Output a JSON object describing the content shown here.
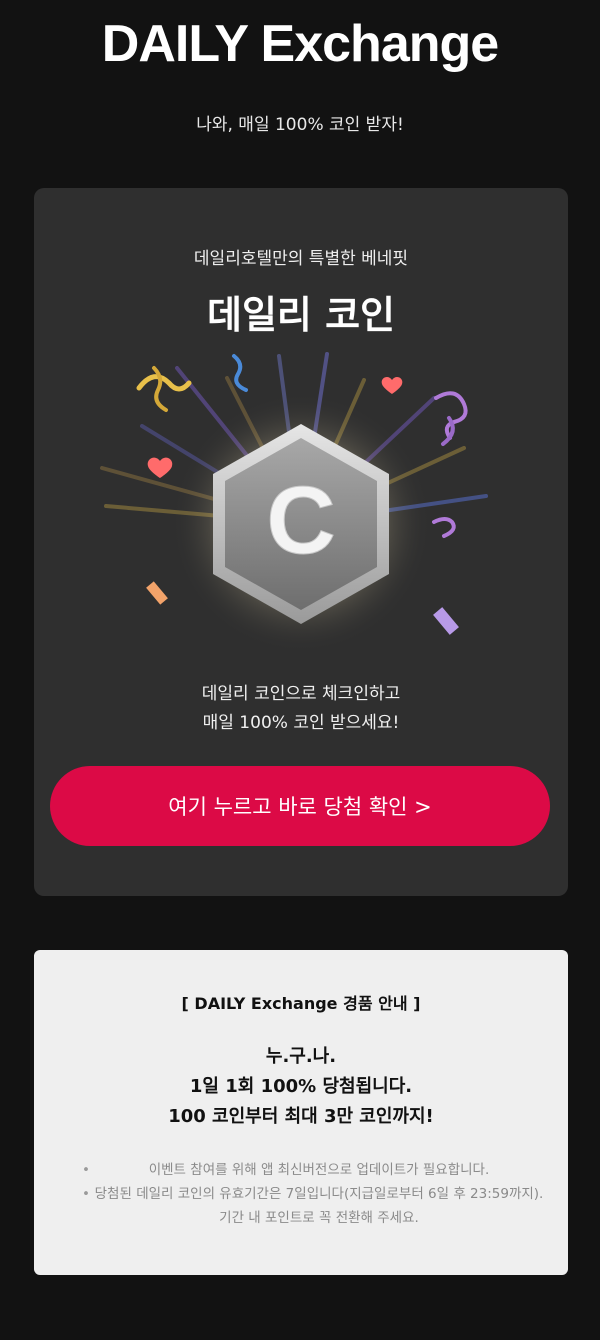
{
  "header": {
    "title": "DAILY Exchange",
    "subtitle": "나와, 매일 100% 코인 받자!"
  },
  "promo_card": {
    "eyebrow": "데일리호텔만의 특별한 베네핏",
    "title": "데일리 코인",
    "coin_letter": "C",
    "description_lines": [
      "데일리 코인으로 체크인하고",
      "매일 100% 코인 받으세요!"
    ],
    "cta_label": "여기 누르고 바로 당첨 확인 >"
  },
  "info_box": {
    "heading": "[ DAILY Exchange 경품 안내 ]",
    "main_lines": [
      "누.구.나.",
      "1일 1회 100% 당첨됩니다.",
      "100 코인부터 최대 3만 코인까지!"
    ],
    "notes": [
      "이벤트 참여를 위해 앱 최신버전으로 업데이트가 필요합니다.",
      "당첨된 데일리 코인의 유효기간은 7일입니다(지급일로부터 6일 후 23:59까지). 기간 내 포인트로 꼭 전환해 주세요."
    ]
  },
  "colors": {
    "background": "#121212",
    "card": "#2f2f2f",
    "cta": "#dc0a46",
    "info_box": "#efefef"
  },
  "icons": [
    "coin-icon",
    "heart-icon",
    "confetti-ribbon-icon"
  ]
}
